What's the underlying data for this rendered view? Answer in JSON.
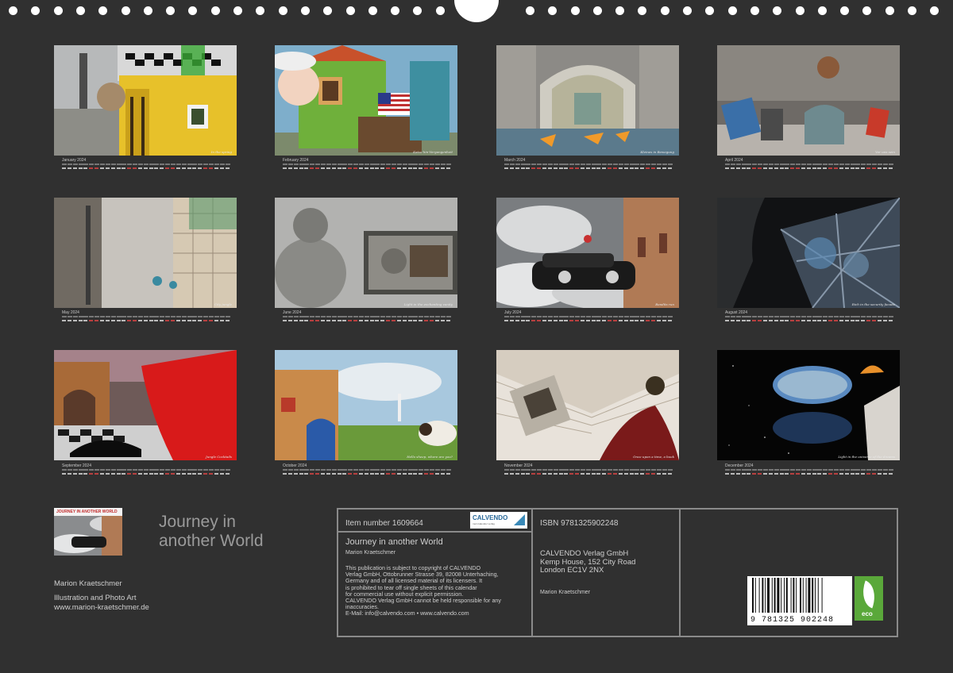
{
  "months": [
    {
      "label": "January 2024",
      "caption": "In the spring"
    },
    {
      "label": "February 2024",
      "caption": "Katze hin-Vergangenheit"
    },
    {
      "label": "March 2024",
      "caption": "Kleines in Bewegung"
    },
    {
      "label": "April 2024",
      "caption": "Vor uns sein"
    },
    {
      "label": "May 2024",
      "caption": "City jungle"
    },
    {
      "label": "June 2024",
      "caption": "Light in the enchanting vanity"
    },
    {
      "label": "July 2024",
      "caption": "Bandits run"
    },
    {
      "label": "August 2024",
      "caption": "Rich in the security facade"
    },
    {
      "label": "September 2024",
      "caption": "Jungle Cocktails"
    },
    {
      "label": "October 2024",
      "caption": "Hello sheep, where are you?"
    },
    {
      "label": "November 2024",
      "caption": "Once upon a time, a book"
    },
    {
      "label": "December 2024",
      "caption": "Light in the universe of the dreams"
    }
  ],
  "brand": {
    "title_line1": "Journey in",
    "title_line2": "another World",
    "thumb_title": "JOURNEY IN ANOTHER WORLD",
    "author": "Marion Kraetschmer",
    "subtitle": "Illustration and Photo Art",
    "website": "www.marion-kraetschmer.de"
  },
  "info": {
    "item_number": "Item number 1609664",
    "calendar_title": "Journey in another World",
    "calendar_author": "Marion Kraetschmer",
    "copyright_lines": [
      "This publication is subject to copyright of CALVENDO",
      "Verlag GmbH, Ottobrunner Strasse 39, 82008 Unterhaching,",
      "Germany and of all licensed material of its licensers. It",
      "is prohibited to tear off single sheets of this calendar",
      "for commercial use without explicit permission.",
      "CALVENDO Verlag GmbH cannot be held responsible for any",
      "inaccuracies.",
      "E-Mail: info@calvendo.com • www.calvendo.com"
    ],
    "isbn": "ISBN 9781325902248",
    "publisher_lines": [
      "CALVENDO Verlag GmbH",
      "Kemp House, 152 City Road",
      "London EC1V 2NX"
    ],
    "publisher_author": "Marion Kraetschmer",
    "barcode_number": "9 781325 902248",
    "logo_name": "CALVENDO",
    "logo_tagline": "mein kalender verlag",
    "eco_label": "eco"
  }
}
